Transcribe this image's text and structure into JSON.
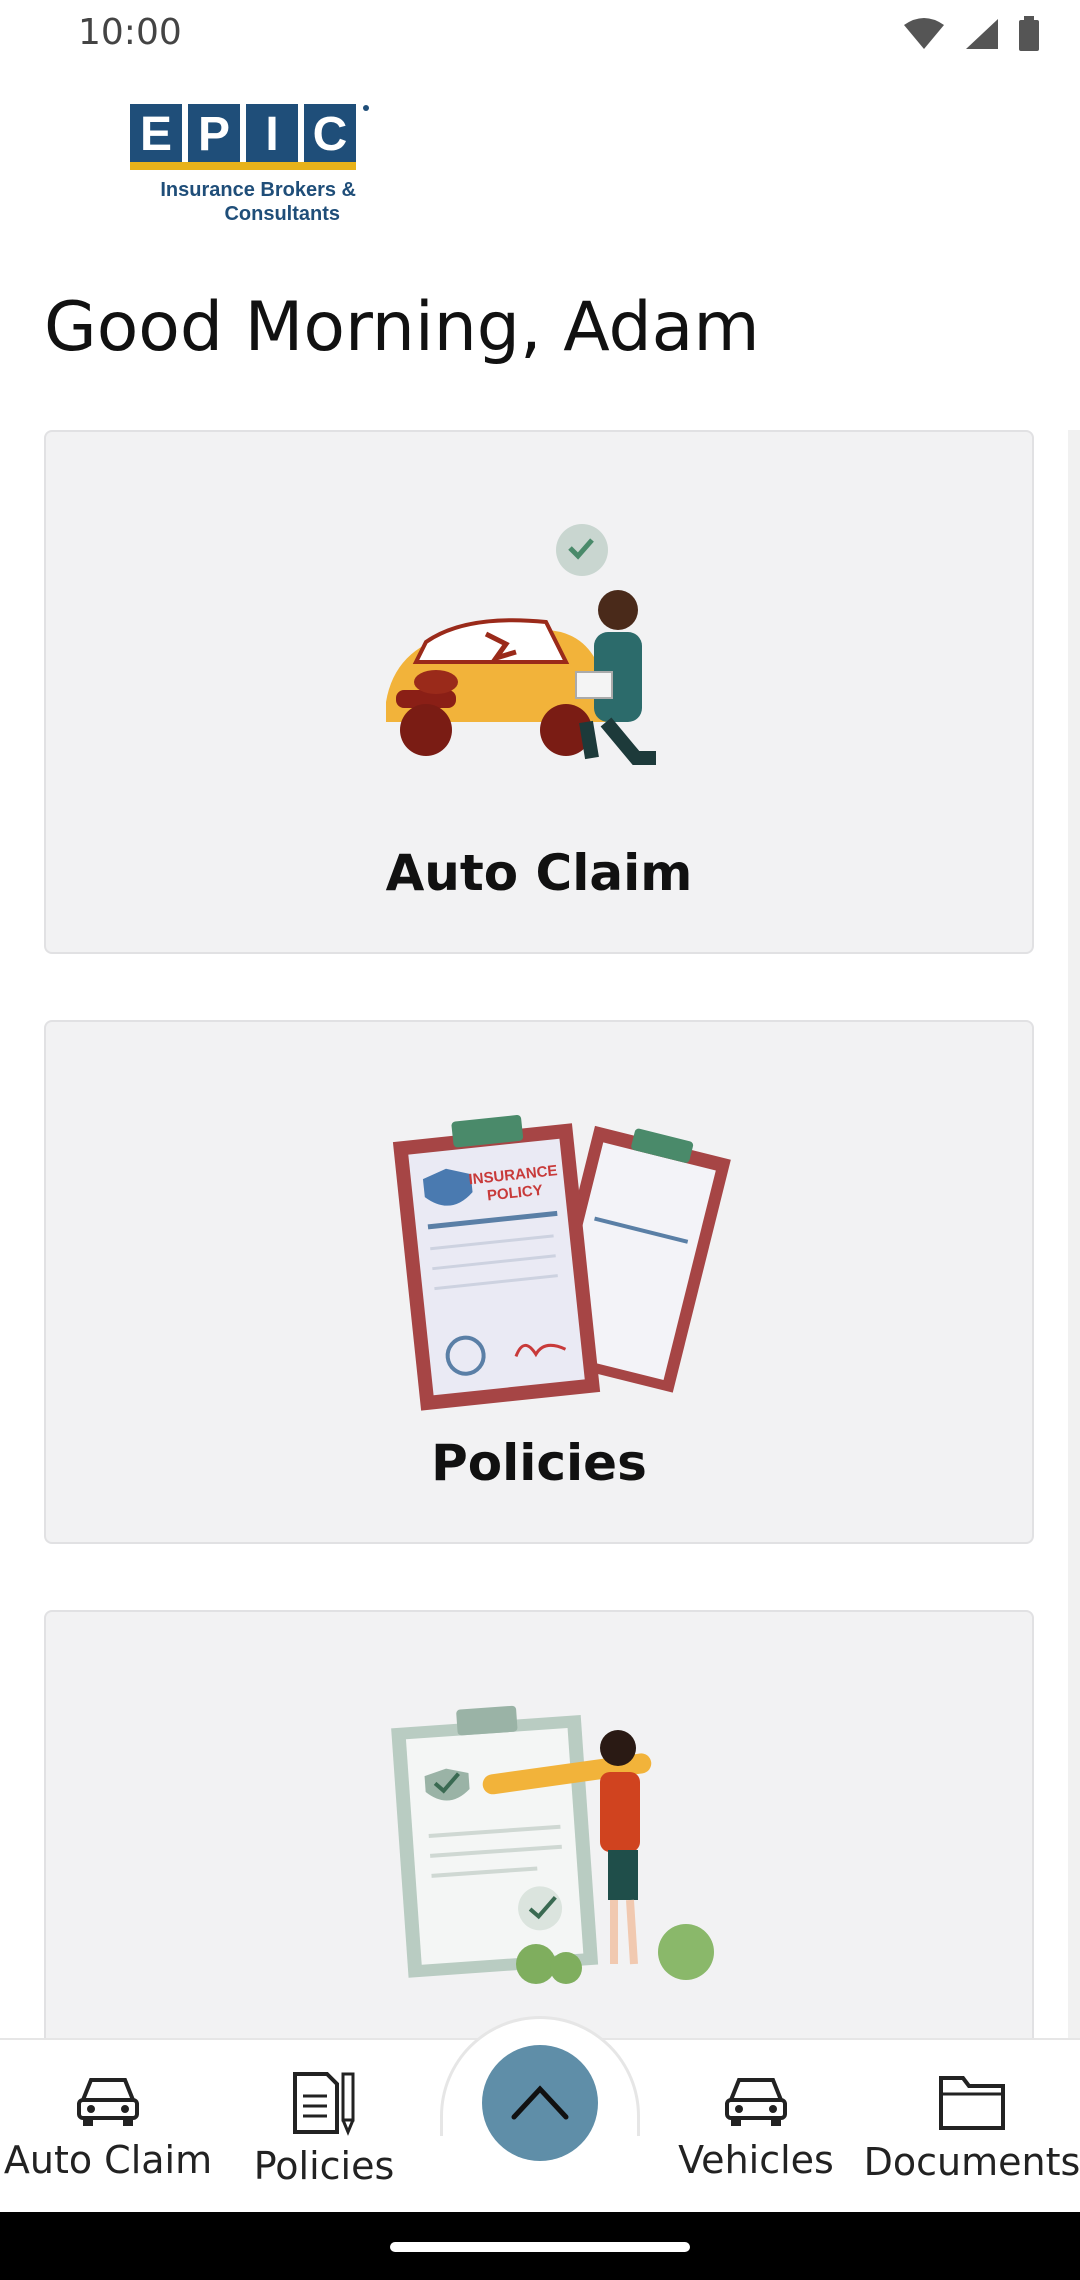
{
  "status_bar": {
    "time": "10:00"
  },
  "logo": {
    "letters": [
      "E",
      "P",
      "I",
      "C"
    ],
    "line1": "Insurance Brokers &",
    "line2": "Consultants",
    "brand_color": "#1f4e79",
    "accent_color": "#e8b21a"
  },
  "greeting": "Good Morning, Adam",
  "cards": [
    {
      "label": "Auto Claim",
      "icon": "car-inspection-illustration"
    },
    {
      "label": "Policies",
      "icon": "insurance-policy-illustration"
    },
    {
      "label": "",
      "icon": "checklist-illustration"
    }
  ],
  "bottom_nav": {
    "items": [
      {
        "label": "Auto Claim",
        "icon": "car-icon"
      },
      {
        "label": "Policies",
        "icon": "document-pen-icon"
      },
      {
        "label": "Vehicles",
        "icon": "car-icon"
      },
      {
        "label": "Documents",
        "icon": "folder-icon"
      }
    ],
    "fab_icon": "chevron-up-icon",
    "fab_color": "#5f8ea8"
  }
}
